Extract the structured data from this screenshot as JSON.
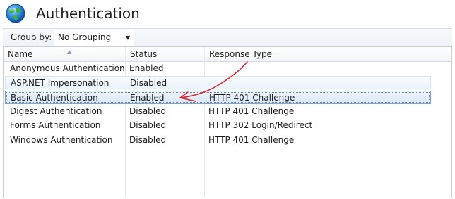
{
  "page": {
    "title": "Authentication",
    "icon": "globe-icon"
  },
  "toolbar": {
    "group_by_label": "Group by:",
    "group_by_value": "No Grouping"
  },
  "table": {
    "columns": [
      "Name",
      "Status",
      "Response Type"
    ],
    "rows": [
      {
        "name": "Anonymous Authentication",
        "status": "Enabled",
        "response": ""
      },
      {
        "name": "ASP.NET Impersonation",
        "status": "Disabled",
        "response": ""
      },
      {
        "name": "Basic Authentication",
        "status": "Enabled",
        "response": "HTTP 401 Challenge"
      },
      {
        "name": "Digest Authentication",
        "status": "Disabled",
        "response": "HTTP 401 Challenge"
      },
      {
        "name": "Forms Authentication",
        "status": "Disabled",
        "response": "HTTP 302 Login/Redirect"
      },
      {
        "name": "Windows Authentication",
        "status": "Disabled",
        "response": "HTTP 401 Challenge"
      }
    ],
    "hover_row": 1,
    "selected_row": 2
  },
  "colors": {
    "annotation": "#e0202a",
    "selection_border": "#7da2ce"
  }
}
